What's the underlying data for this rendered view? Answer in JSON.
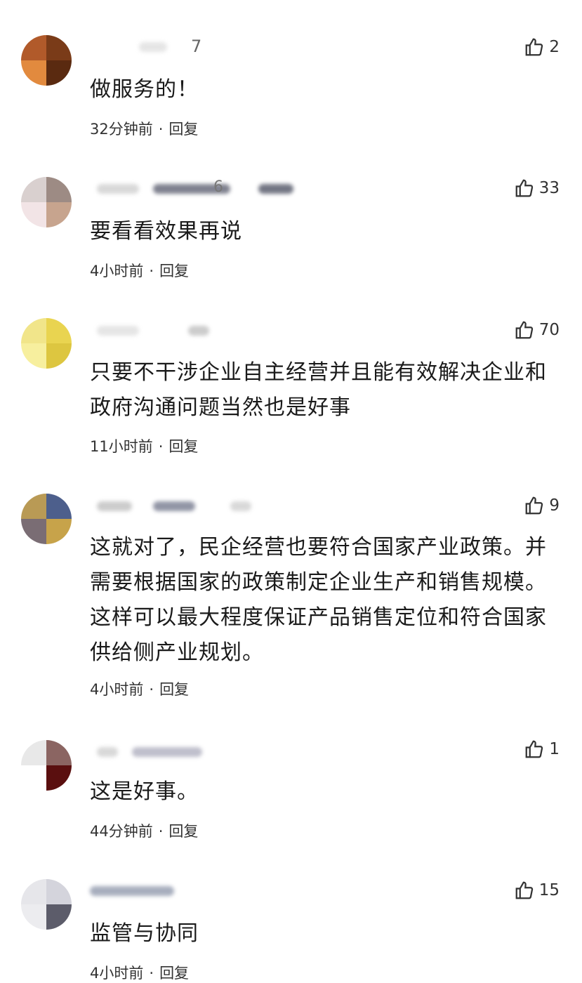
{
  "comments": [
    {
      "name_visible": "7",
      "likes": "2",
      "text": "做服务的！",
      "time": "32分钟前",
      "reply": "回复",
      "avatar": [
        "#b15a2a",
        "#7a3b18",
        "#e28a3e",
        "#5a2a10"
      ]
    },
    {
      "name_visible": "6",
      "likes": "33",
      "text": "要看看效果再说",
      "time": "4小时前",
      "reply": "回复",
      "avatar": [
        "#d9d0cf",
        "#9d8b84",
        "#f2e4e6",
        "#c7a48e"
      ]
    },
    {
      "name_visible": "",
      "likes": "70",
      "text": "只要不干涉企业自主经营并且能有效解决企业和政府沟通问题当然也是好事",
      "time": "11小时前",
      "reply": "回复",
      "avatar": [
        "#f1e58a",
        "#e9d450",
        "#f7ef9e",
        "#ddc640"
      ]
    },
    {
      "name_visible": "",
      "likes": "9",
      "text": "这就对了，民企经营也要符合国家产业政策。并需要根据国家的政策制定企业生产和销售规模。这样可以最大程度保证产品销售定位和符合国家供给侧产业规划。",
      "time": "4小时前",
      "reply": "回复",
      "avatar": [
        "#b99a55",
        "#4d5f8c",
        "#7a6d74",
        "#c7a34a"
      ]
    },
    {
      "name_visible": "",
      "likes": "1",
      "text": "这是好事。",
      "time": "44分钟前",
      "reply": "回复",
      "avatar": [
        "#e8e8e8",
        "#8b6562",
        "#ffffff",
        "#5a0f0f"
      ]
    },
    {
      "name_visible": "",
      "likes": "15",
      "text": "监管与协同",
      "time": "4小时前",
      "reply": "回复",
      "avatar": [
        "#e6e6ea",
        "#d4d4dc",
        "#ececef",
        "#5c5c6a"
      ]
    }
  ],
  "icons": {
    "like": "thumbs-up-icon"
  },
  "colors": {
    "text": "#1a1a1a",
    "meta": "#333333",
    "background": "#ffffff"
  }
}
